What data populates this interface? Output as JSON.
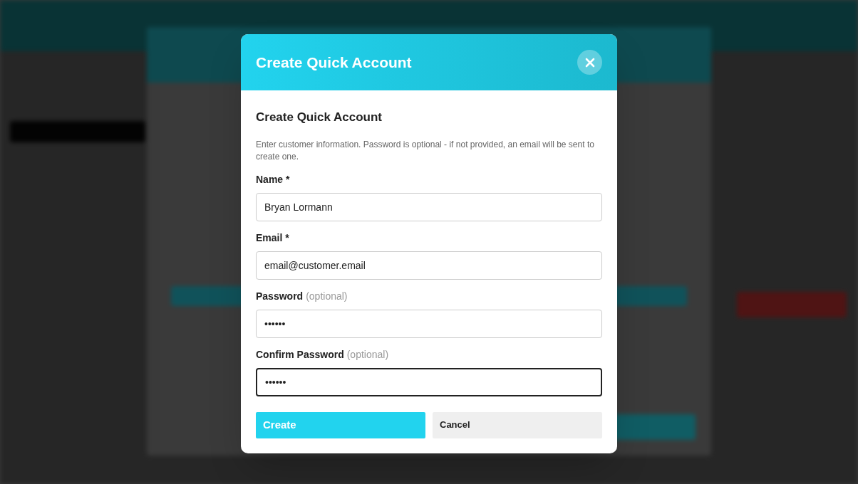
{
  "dialog": {
    "title": "Create Quick Account",
    "heading": "Create Quick Account",
    "description": "Enter customer information. Password is optional - if not provided, an email will be sent to create one.",
    "fields": [
      {
        "label": "Name *",
        "value": "Bryan Lormann",
        "focused": false
      },
      {
        "label": "Email *",
        "value": "email@customer.email",
        "focused": false
      },
      {
        "label": "Password",
        "hint": "(optional)",
        "value": "••••••",
        "focused": false
      },
      {
        "label": "Confirm Password",
        "hint": "(optional)",
        "value": "••••••",
        "focused": true
      }
    ],
    "buttons": [
      {
        "label": "Create",
        "kind": "primary"
      },
      {
        "label": "Cancel",
        "kind": "secondary"
      }
    ]
  }
}
